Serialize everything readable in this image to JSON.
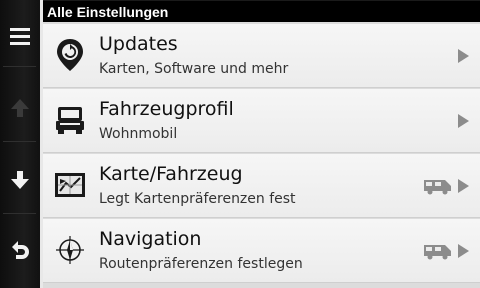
{
  "header": {
    "title": "Alle Einstellungen"
  },
  "sidebar": {
    "menu_icon": "menu-icon",
    "up_icon": "arrow-up-icon",
    "down_icon": "arrow-down-icon",
    "back_icon": "back-icon"
  },
  "items": [
    {
      "title": "Updates",
      "subtitle": "Karten, Software und mehr",
      "icon": "update-pin-icon"
    },
    {
      "title": "Fahrzeugprofil",
      "subtitle": "Wohnmobil",
      "icon": "truck-icon"
    },
    {
      "title": "Karte/Fahrzeug",
      "subtitle": "Legt Kartenpräferenzen fest",
      "icon": "map-vehicle-icon",
      "badge_icon": "camper-icon"
    },
    {
      "title": "Navigation",
      "subtitle": "Routenpräferenzen festlegen",
      "icon": "navigation-icon",
      "badge_icon": "camper-icon"
    }
  ],
  "colors": {
    "header_bg": "#000000",
    "list_bg": "#f2f2f2",
    "title_text": "#111111",
    "subtitle_text": "#333333",
    "icon_gray": "#8c8c8c"
  }
}
